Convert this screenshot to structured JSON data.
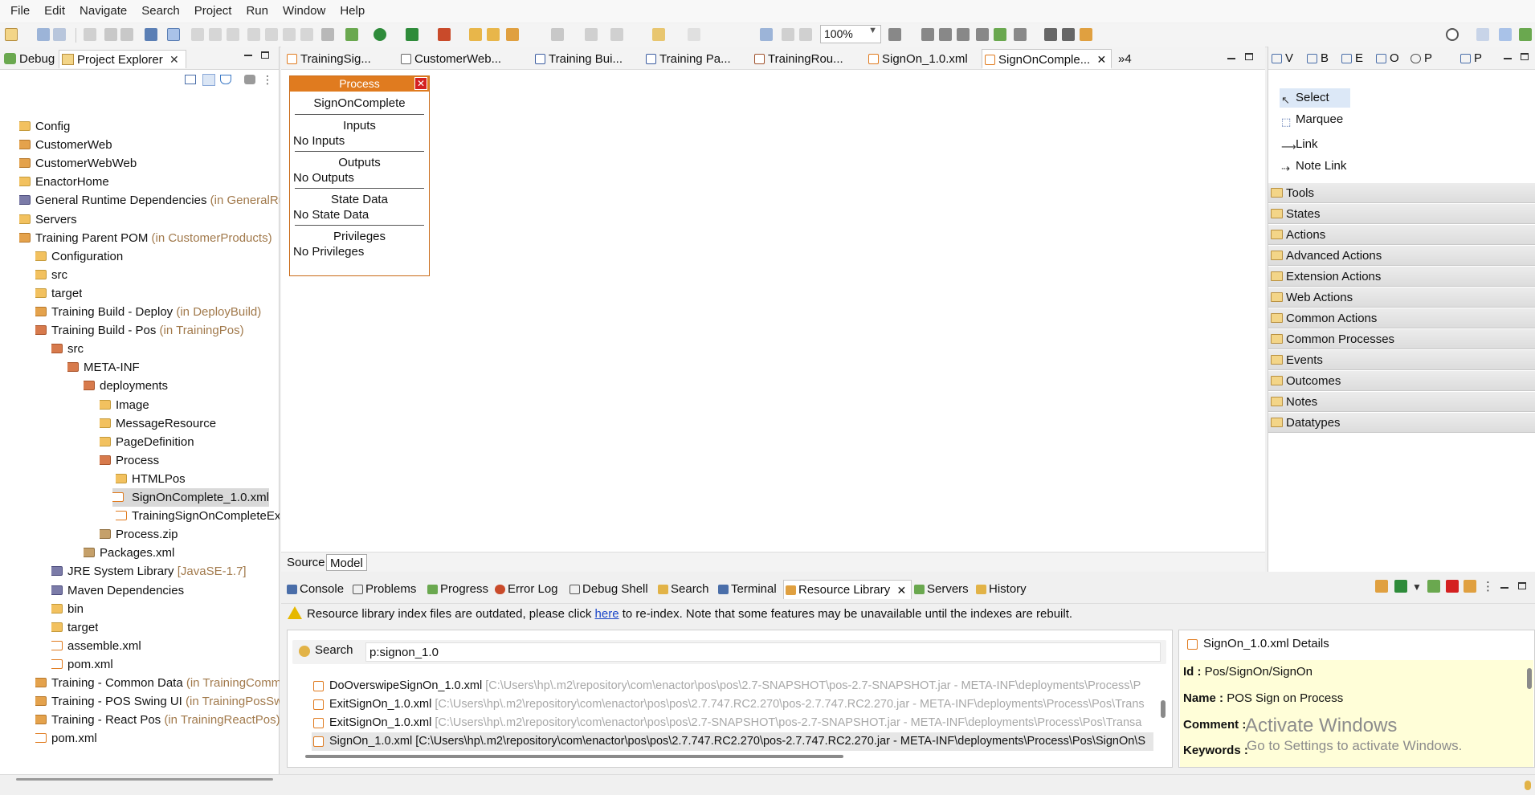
{
  "menu": [
    "File",
    "Edit",
    "Navigate",
    "Search",
    "Project",
    "Run",
    "Window",
    "Help"
  ],
  "toolbar": {
    "zoom": "100%"
  },
  "left_pane": {
    "tabs": [
      {
        "label": "Debug"
      },
      {
        "label": "Project Explorer"
      }
    ],
    "tree": [
      {
        "label": "Config",
        "sub": ""
      },
      {
        "label": "CustomerWeb",
        "sub": ""
      },
      {
        "label": "CustomerWebWeb",
        "sub": ""
      },
      {
        "label": "EnactorHome",
        "sub": ""
      },
      {
        "label": "General Runtime Dependencies",
        "sub": "(in GeneralRun"
      },
      {
        "label": "Servers",
        "sub": ""
      },
      {
        "label": "Training Parent POM",
        "sub": "(in CustomerProducts)"
      },
      {
        "label": "Configuration",
        "sub": ""
      },
      {
        "label": "src",
        "sub": ""
      },
      {
        "label": "target",
        "sub": ""
      },
      {
        "label": "Training Build - Deploy",
        "sub": "(in DeployBuild)"
      },
      {
        "label": "Training Build - Pos",
        "sub": "(in TrainingPos)"
      },
      {
        "label": "src",
        "sub": ""
      },
      {
        "label": "META-INF",
        "sub": ""
      },
      {
        "label": "deployments",
        "sub": ""
      },
      {
        "label": "Image",
        "sub": ""
      },
      {
        "label": "MessageResource",
        "sub": ""
      },
      {
        "label": "PageDefinition",
        "sub": ""
      },
      {
        "label": "Process",
        "sub": ""
      },
      {
        "label": "HTMLPos",
        "sub": ""
      },
      {
        "label": "SignOnComplete_1.0.xml",
        "sub": ""
      },
      {
        "label": "TrainingSignOnCompleteExt",
        "sub": ""
      },
      {
        "label": "Process.zip",
        "sub": ""
      },
      {
        "label": "Packages.xml",
        "sub": ""
      },
      {
        "label": "JRE System Library",
        "sub": "[JavaSE-1.7]"
      },
      {
        "label": "Maven Dependencies",
        "sub": ""
      },
      {
        "label": "bin",
        "sub": ""
      },
      {
        "label": "target",
        "sub": ""
      },
      {
        "label": "assemble.xml",
        "sub": ""
      },
      {
        "label": "pom.xml",
        "sub": ""
      },
      {
        "label": "Training - Common Data",
        "sub": "(in TrainingComm"
      },
      {
        "label": "Training - POS Swing UI",
        "sub": "(in TrainingPosSwin"
      },
      {
        "label": "Training - React Pos",
        "sub": "(in TrainingReactPos)"
      },
      {
        "label": "pom.xml",
        "sub": ""
      }
    ]
  },
  "editor": {
    "tabs": [
      "TrainingSig...",
      "CustomerWeb...",
      "Training Bui...",
      "Training Pa...",
      "TrainingRou...",
      "SignOn_1.0.xml",
      "SignOnComple...",
      "»4"
    ],
    "process": {
      "header": "Process",
      "name": "SignOnComplete",
      "sections": [
        {
          "heading": "Inputs",
          "value": "No Inputs"
        },
        {
          "heading": "Outputs",
          "value": "No Outputs"
        },
        {
          "heading": "State Data",
          "value": "No State Data"
        },
        {
          "heading": "Privileges",
          "value": "No Privileges"
        }
      ]
    },
    "bottom_tabs": [
      "Source",
      "Model"
    ]
  },
  "palette": {
    "tabs": [
      "V",
      "B",
      "E",
      "O",
      "P",
      "P"
    ],
    "tools": [
      "Select",
      "Marquee",
      "Link",
      "Note Link"
    ],
    "drawers": [
      "Tools",
      "States",
      "Actions",
      "Advanced Actions",
      "Extension Actions",
      "Web Actions",
      "Common Actions",
      "Common Processes",
      "Events",
      "Outcomes",
      "Notes",
      "Datatypes"
    ]
  },
  "bottom": {
    "tabs": [
      "Console",
      "Problems",
      "Progress",
      "Error Log",
      "Debug Shell",
      "Search",
      "Terminal",
      "Resource Library",
      "Servers",
      "History"
    ],
    "warning": {
      "before": "Resource library index files are outdated, please click ",
      "link": "here",
      "after": " to re-index. Note that some features may be unavailable until the indexes are rebuilt."
    },
    "search": {
      "label": "Search",
      "value": "p:signon_1.0",
      "results": [
        {
          "name": "DoOverswipeSignOn_1.0.xml",
          "path": "[C:\\Users\\hp\\.m2\\repository\\com\\enactor\\pos\\pos\\2.7-SNAPSHOT\\pos-2.7-SNAPSHOT.jar - META-INF\\deployments\\Process\\P"
        },
        {
          "name": "ExitSignOn_1.0.xml",
          "path": "[C:\\Users\\hp\\.m2\\repository\\com\\enactor\\pos\\pos\\2.7.747.RC2.270\\pos-2.7.747.RC2.270.jar - META-INF\\deployments\\Process\\Pos\\Trans"
        },
        {
          "name": "ExitSignOn_1.0.xml",
          "path": "[C:\\Users\\hp\\.m2\\repository\\com\\enactor\\pos\\pos\\2.7-SNAPSHOT\\pos-2.7-SNAPSHOT.jar - META-INF\\deployments\\Process\\Pos\\Transa"
        },
        {
          "name": "SignOn_1.0.xml",
          "path": "[C:\\Users\\hp\\.m2\\repository\\com\\enactor\\pos\\pos\\2.7.747.RC2.270\\pos-2.7.747.RC2.270.jar - META-INF\\deployments\\Process\\Pos\\SignOn\\S"
        }
      ]
    },
    "details": {
      "title": "SignOn_1.0.xml Details",
      "id_label": "Id :",
      "id_value": "Pos/SignOn/SignOn",
      "name_label": "Name :",
      "name_value": "POS Sign on Process",
      "comment_label": "Comment :",
      "keywords_label": "Keywords :"
    }
  },
  "watermark": {
    "line1": "Activate Windows",
    "line2": "Go to Settings to activate Windows."
  }
}
